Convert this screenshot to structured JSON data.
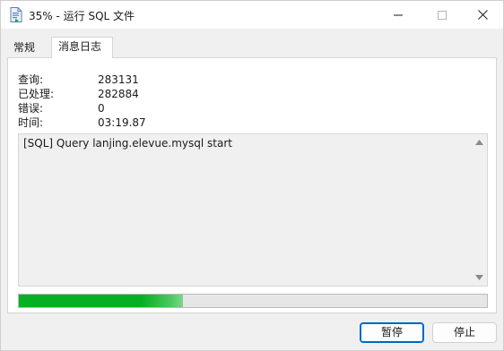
{
  "window": {
    "title": "35% - 运行 SQL 文件",
    "icon": "sql-file-icon"
  },
  "tabs": [
    {
      "label": "常规",
      "active": false
    },
    {
      "label": "消息日志",
      "active": true
    }
  ],
  "stats": [
    {
      "label": "查询:",
      "value": "283131"
    },
    {
      "label": "已处理:",
      "value": "282884"
    },
    {
      "label": "错误:",
      "value": "0"
    },
    {
      "label": "时间:",
      "value": "03:19.87"
    }
  ],
  "log": {
    "lines": [
      "[SQL] Query lanjing.elevue.mysql start"
    ]
  },
  "progress": {
    "percent": 35,
    "color": "#06b025"
  },
  "buttons": {
    "pause": "暂停",
    "stop": "停止"
  }
}
